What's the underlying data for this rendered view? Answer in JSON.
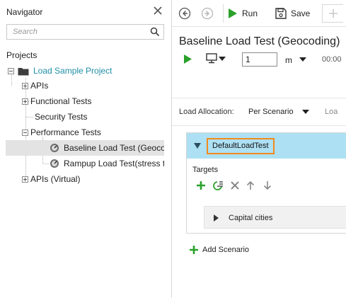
{
  "navigator": {
    "title": "Navigator",
    "search_placeholder": "Search",
    "projects_label": "Projects",
    "tree": {
      "project": "Load Sample Project",
      "apis": "APIs",
      "functional": "Functional Tests",
      "security": "Security Tests",
      "performance": "Performance Tests",
      "baseline": "Baseline Load Test (Geocoding",
      "rampup": "Rampup Load Test(stress test",
      "apis_virtual": "APIs (Virtual)"
    }
  },
  "toolbar": {
    "run_label": "Run",
    "save_label": "Save"
  },
  "editor": {
    "title": "Baseline Load Test (Geocoding)",
    "duration_value": "1",
    "duration_unit": "m",
    "time_display": "00:00",
    "load_allocation_label": "Load Allocation:",
    "load_allocation_value": "Per Scenario",
    "next_label_partial": "Loa"
  },
  "scenario": {
    "name": "DefaultLoadTest",
    "targets_label": "Targets",
    "target_item": "Capital cities",
    "add_label": "Add Scenario"
  },
  "colors": {
    "accent_green": "#2aa12a",
    "link_teal": "#1f8ea6",
    "header_blue": "#aee0f3",
    "highlight_orange": "#f08a1d",
    "selection_gray": "#e3e3e3"
  }
}
